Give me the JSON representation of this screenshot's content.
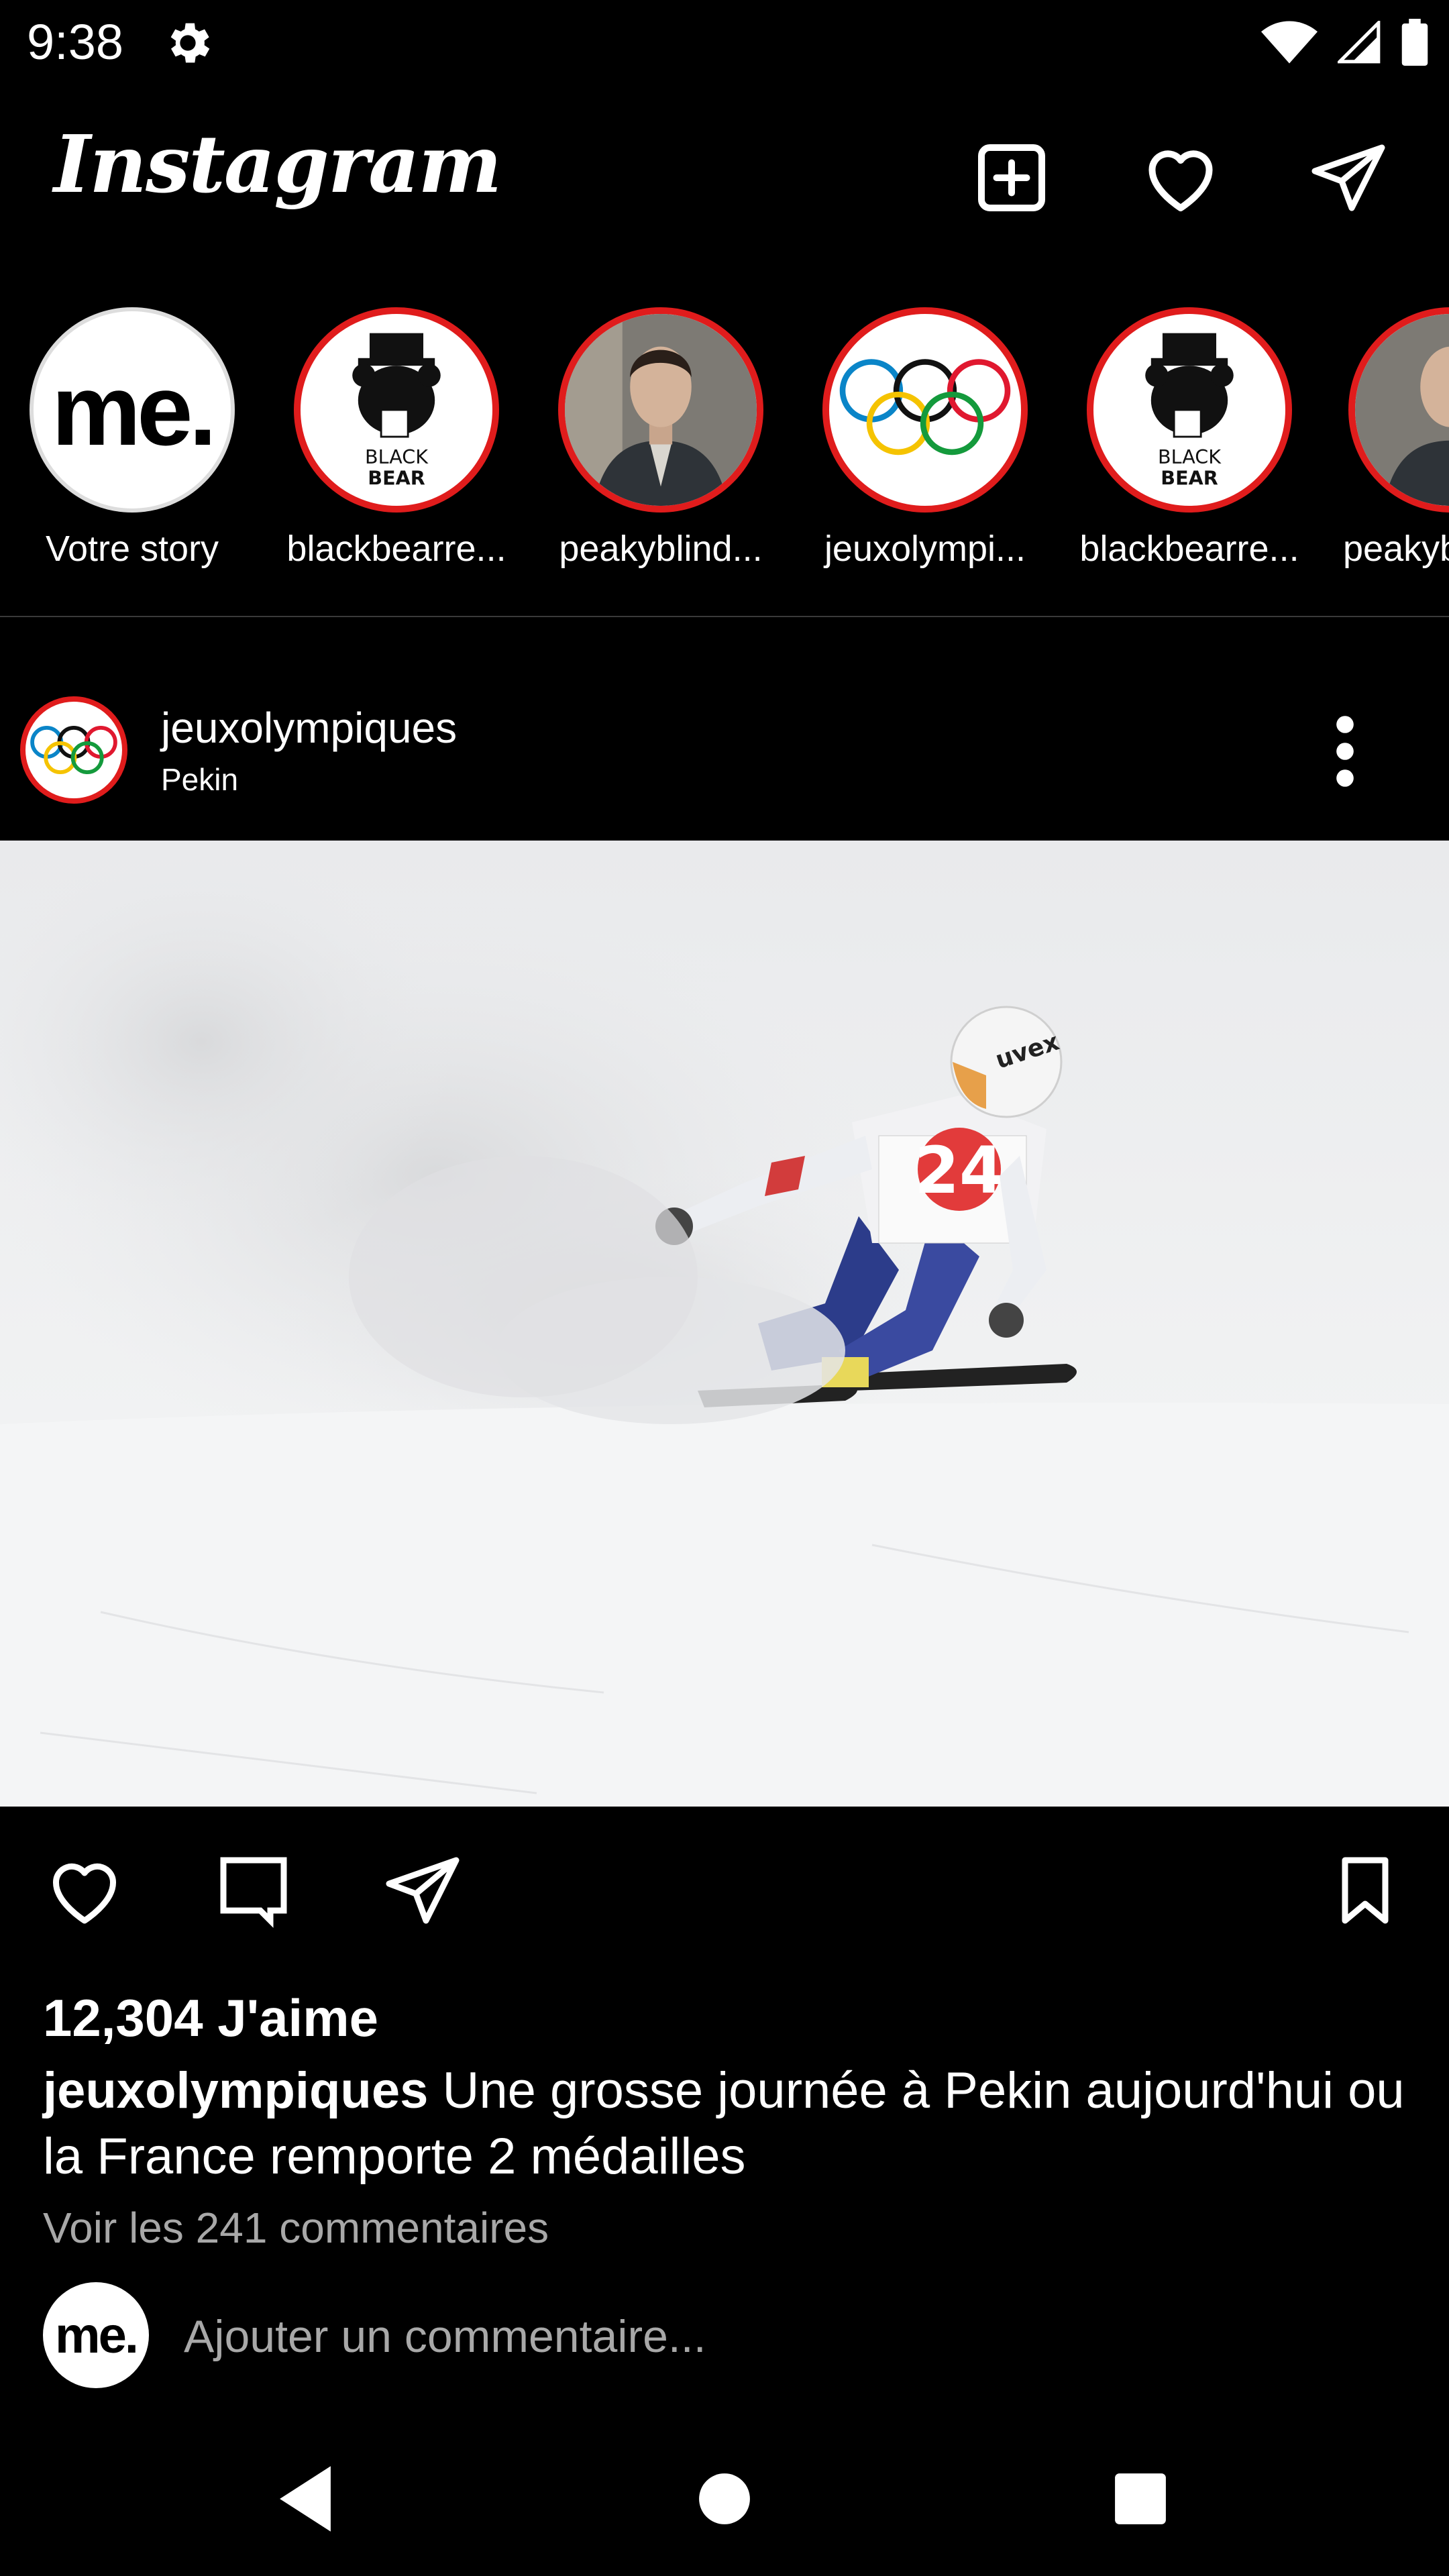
{
  "status_bar": {
    "time": "9:38",
    "icons": [
      "gear-icon",
      "wifi-icon",
      "signal-icon",
      "battery-icon"
    ]
  },
  "header": {
    "logo_text": "Instagram",
    "icons": [
      "new-post-icon",
      "activity-heart-icon",
      "direct-message-icon"
    ]
  },
  "stories": [
    {
      "label": "Votre story",
      "avatar": "me."
    },
    {
      "label": "blackbearre...",
      "avatar": "black-bear-logo"
    },
    {
      "label": "peakyblind...",
      "avatar": "portrait"
    },
    {
      "label": "jeuxolympi...",
      "avatar": "olympic-rings"
    },
    {
      "label": "blackbearre...",
      "avatar": "black-bear-logo"
    },
    {
      "label": "peakyb",
      "avatar": "portrait"
    }
  ],
  "bear_logo": {
    "line1": "BLACK",
    "line2": "BEAR"
  },
  "post": {
    "username": "jeuxolympiques",
    "location": "Pekin",
    "image_bib": "24",
    "image_brand": "uvex",
    "likes": "12,304 J'aime",
    "caption_user": "jeuxolympiques",
    "caption_text": " Une grosse journée à Pekin aujourd'hui ou la France remporte 2 médailles",
    "view_comments": "Voir les 241 commentaires",
    "comment_placeholder": "Ajouter un commentaire...",
    "comment_avatar": "me."
  },
  "colors": {
    "background": "#000000",
    "story_ring": "#e01c1c",
    "secondary_text": "#a8a8a8"
  }
}
